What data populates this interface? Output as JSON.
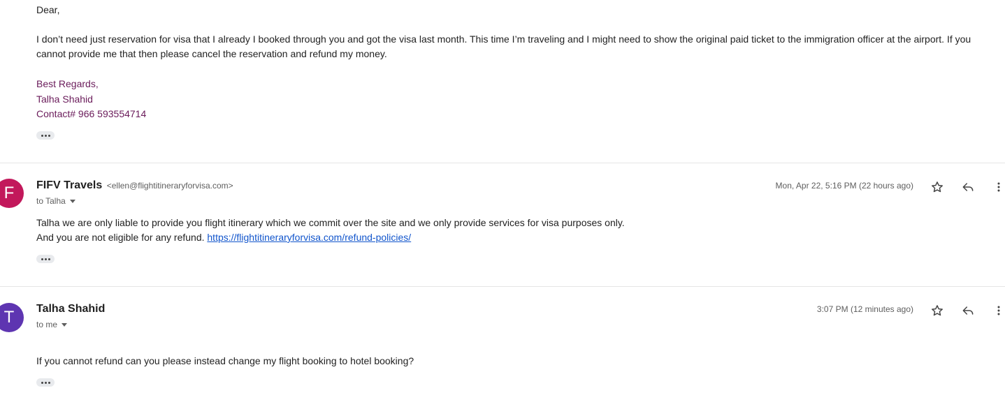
{
  "message1": {
    "greeting": "Dear,",
    "body_line1": "I don’t need just reservation for visa that I already I booked through you and got the visa last month. This time I’m traveling and I might need to show the original paid ticket to the immigration officer at the airport. If you",
    "body_line2": "cannot provide me that then please cancel the reservation and refund my money.",
    "signature": [
      "Best Regards,",
      "Talha Shahid",
      "Contact# 966 593554714"
    ]
  },
  "message2": {
    "avatar_letter": "F",
    "avatar_color": "#c2185b",
    "sender_name": "FIFV Travels",
    "sender_email": "<ellen@flightitineraryforvisa.com>",
    "recipient": "to Talha",
    "timestamp": "Mon, Apr 22, 5:16 PM (22 hours ago)",
    "body_line1": "Talha we are only liable to provide you flight itinerary which we commit over the site and we only provide services for visa purposes only.",
    "body_line2_prefix": "And you are not eligible for any refund.",
    "link": "https://flightitineraryforvisa.com/refund-policies/"
  },
  "message3": {
    "avatar_letter": "T",
    "avatar_color": "#5e35b1",
    "sender_name": "Talha Shahid",
    "recipient": "to me",
    "timestamp": "3:07 PM (12 minutes ago)",
    "body": "If you cannot refund can you please instead change my flight booking to hotel booking?"
  },
  "icons": [
    "star-icon",
    "reply-icon",
    "more-vert-icon",
    "chevron-down-icon",
    "show-trimmed-content-icon"
  ]
}
